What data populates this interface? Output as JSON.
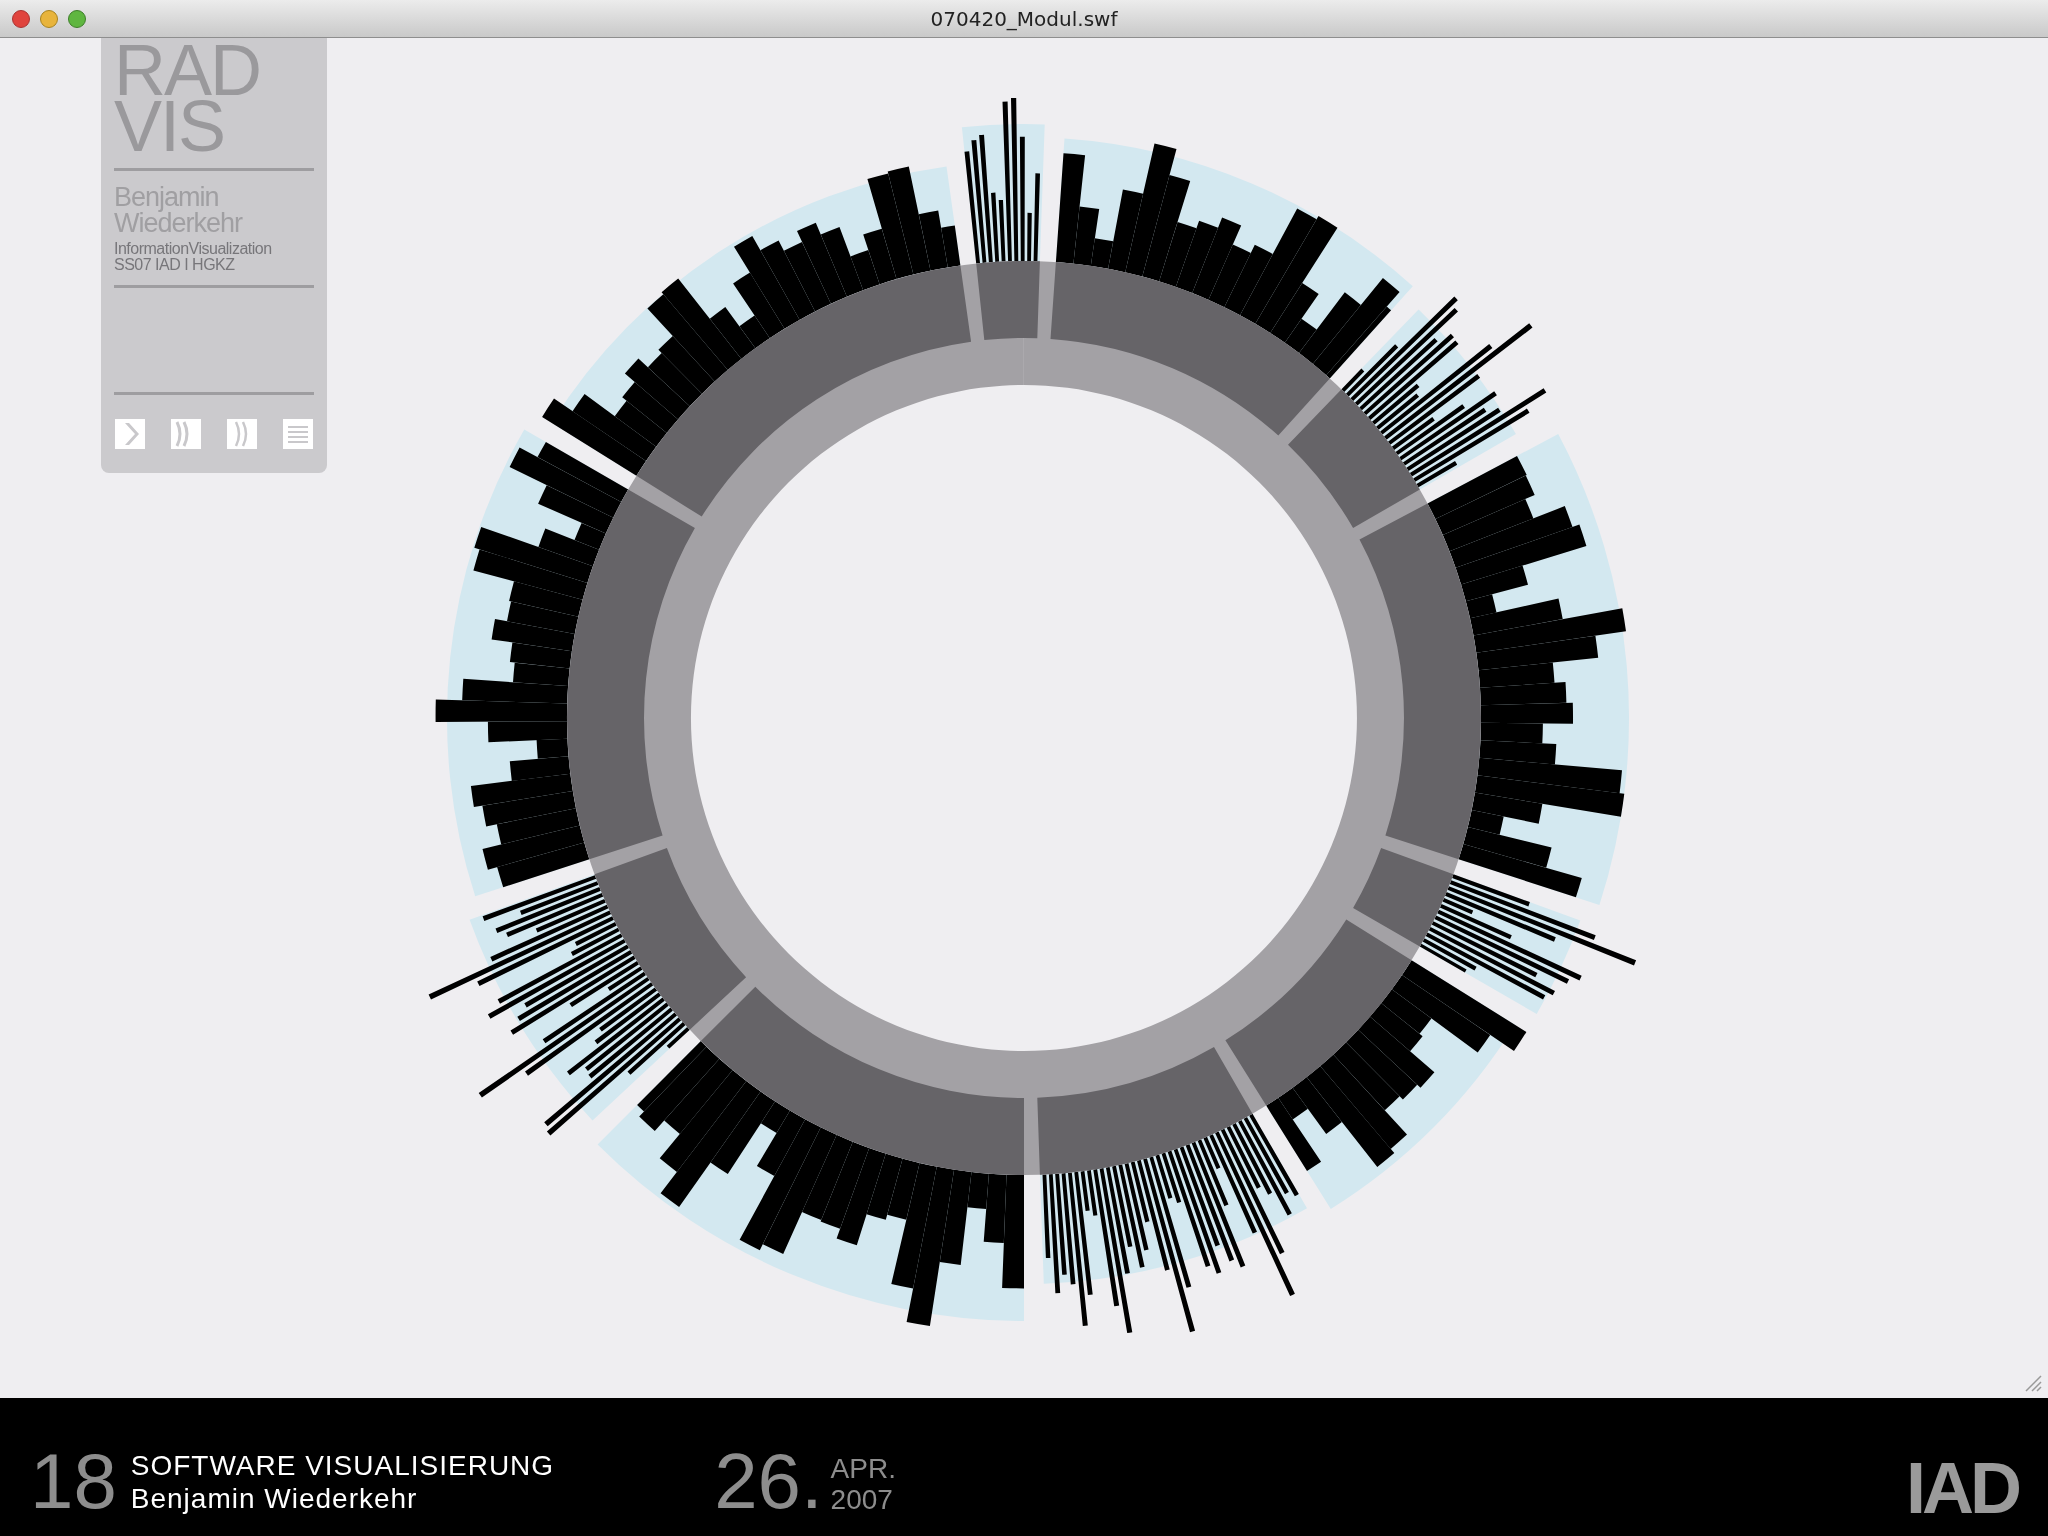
{
  "window": {
    "title": "070420_Modul.swf"
  },
  "panel": {
    "title_lines": [
      "RAD",
      "VIS"
    ],
    "author_lines": [
      "Benjamin",
      "Wiederkehr"
    ],
    "subtitle_lines": [
      "InformationVisualization",
      "SS07 IAD I HGKZ"
    ],
    "controls": [
      {
        "kind": "play"
      },
      {
        "kind": "step"
      },
      {
        "kind": "skip"
      },
      {
        "kind": "list"
      }
    ]
  },
  "footer": {
    "number": "18",
    "title": "SOFTWARE VISUALISIERUNG",
    "speaker": "Benjamin Wiederkehr",
    "day": "26.",
    "month": "APR.",
    "year": "2007",
    "logo": "IAD"
  }
}
